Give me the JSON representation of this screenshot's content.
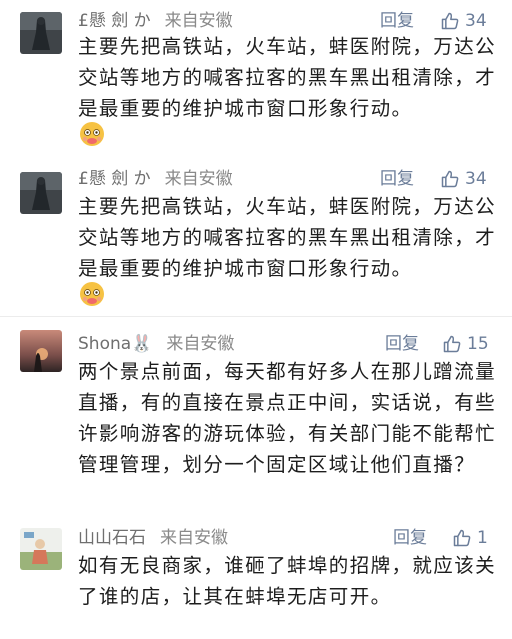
{
  "comments": [
    {
      "username": "£懸 劍 か",
      "location": "来自安徽",
      "reply_label": "回复",
      "likes": "34",
      "text": "主要先把高铁站，火车站，蚌医附院，万达公交站等地方的喊客拉客的黑车黑出租清除，才是最重要的维护城市窗口形象行动。",
      "has_emoji": true
    },
    {
      "username": "£懸 劍 か",
      "location": "来自安徽",
      "reply_label": "回复",
      "likes": "34",
      "text": "主要先把高铁站，火车站，蚌医附院，万达公交站等地方的喊客拉客的黑车黑出租清除，才是最重要的维护城市窗口形象行动。",
      "has_emoji": true
    },
    {
      "username": "Shona🐰",
      "location": "来自安徽",
      "reply_label": "回复",
      "likes": "15",
      "text": "两个景点前面，每天都有好多人在那儿蹭流量直播，有的直接在景点正中间，实话说，有些许影响游客的游玩体验，有关部门能不能帮忙管理管理，划分一个固定区域让他们直播？",
      "has_emoji": false
    },
    {
      "username": "山山石石",
      "location": "来自安徽",
      "reply_label": "回复",
      "likes": "1",
      "text": "如有无良商家，谁砸了蚌埠的招牌，就应该关了谁的店，让其在蚌埠无店可开。",
      "has_emoji": false
    }
  ],
  "colors": {
    "meta": "#7a7a7a",
    "action": "#6b7d99",
    "text": "#1d1d1d"
  }
}
